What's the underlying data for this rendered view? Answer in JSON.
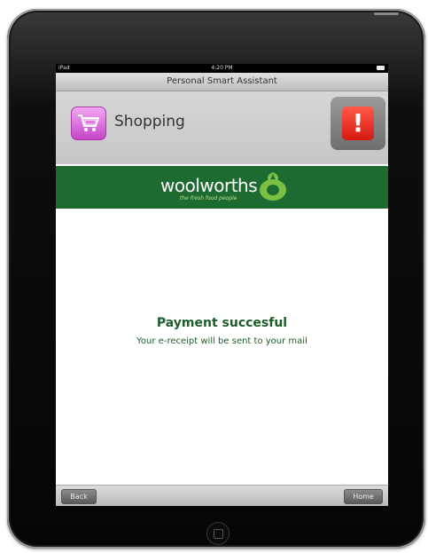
{
  "status_bar": {
    "device": "iPad",
    "time": "4:20 PM"
  },
  "app": {
    "title": "Personal Smart Assistant"
  },
  "header": {
    "section_label": "Shopping",
    "section_icon": "shopping-cart-icon",
    "alert_symbol": "!"
  },
  "brand": {
    "name": "woolworths",
    "tagline": "the fresh food people",
    "color": "#1e6b32"
  },
  "message": {
    "title": "Payment succesful",
    "subtitle": "Your e-receipt will be sent to your mail"
  },
  "footer": {
    "back_label": "Back",
    "home_label": "Home"
  }
}
